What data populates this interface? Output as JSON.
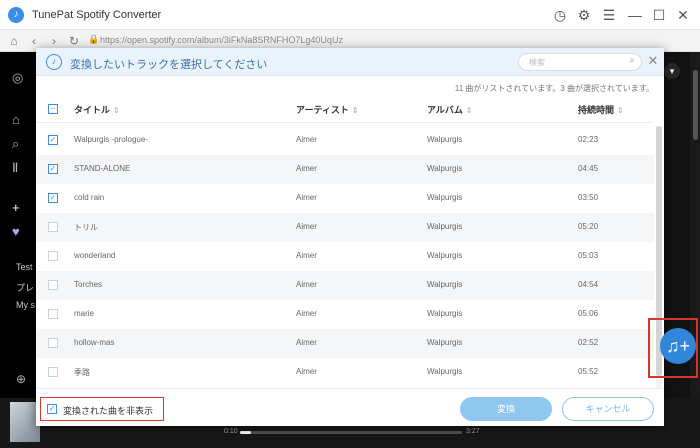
{
  "window": {
    "title": "TunePat Spotify Converter",
    "logo_glyph": "♪"
  },
  "browser": {
    "url": "https://open.spotify.com/album/3iFkNa8SRNFHO7Lg40UqUz"
  },
  "spotify": {
    "sidebar_text": [
      "Test",
      "プレ",
      "My s"
    ],
    "time_elapsed": "0:10",
    "time_total": "3:27",
    "progress_fraction": 0.05
  },
  "dialog": {
    "title": "変換したいトラックを選択してください",
    "search_placeholder": "検索",
    "count_info": "11 曲がリストされています。3 曲が選択されています。",
    "headers": {
      "title": "タイトル",
      "artist": "アーティスト",
      "album": "アルバム",
      "duration": "持続時間",
      "sort_glyph": "⇕"
    },
    "tracks": [
      {
        "title": "Walpurgis -prologue-",
        "artist": "Aimer",
        "album": "Walpurgis",
        "duration": "02:23",
        "checked": true
      },
      {
        "title": "STAND-ALONE",
        "artist": "Aimer",
        "album": "Walpurgis",
        "duration": "04:45",
        "checked": true
      },
      {
        "title": "cold rain",
        "artist": "Aimer",
        "album": "Walpurgis",
        "duration": "03:50",
        "checked": true
      },
      {
        "title": "トリル",
        "artist": "Aimer",
        "album": "Walpurgis",
        "duration": "05:20",
        "checked": false
      },
      {
        "title": "wonderland",
        "artist": "Aimer",
        "album": "Walpurgis",
        "duration": "05:03",
        "checked": false
      },
      {
        "title": "Torches",
        "artist": "Aimer",
        "album": "Walpurgis",
        "duration": "04:54",
        "checked": false
      },
      {
        "title": "marie",
        "artist": "Aimer",
        "album": "Walpurgis",
        "duration": "05:06",
        "checked": false
      },
      {
        "title": "hollow-mas",
        "artist": "Aimer",
        "album": "Walpurgis",
        "duration": "02:52",
        "checked": false
      },
      {
        "title": "季路",
        "artist": "Aimer",
        "album": "Walpurgis",
        "duration": "05:52",
        "checked": false
      }
    ],
    "hide_converted_label": "変換された曲を非表示",
    "hide_converted_checked": true,
    "convert_label": "変換",
    "cancel_label": "キャンセル"
  },
  "icons": {
    "back": "‹",
    "forward": "›",
    "reload": "↻",
    "home": "⌂",
    "lock": "🔒",
    "history": "◷",
    "settings": "⚙",
    "menu": "☰",
    "minimize": "—",
    "maximize": "☐",
    "close": "✕",
    "search": "⌕",
    "add_music": "♫+",
    "check": "✓"
  },
  "colors": {
    "accent": "#3a8ee6",
    "highlight_red": "#d9362b",
    "convert_button": "#8fc7f0"
  }
}
